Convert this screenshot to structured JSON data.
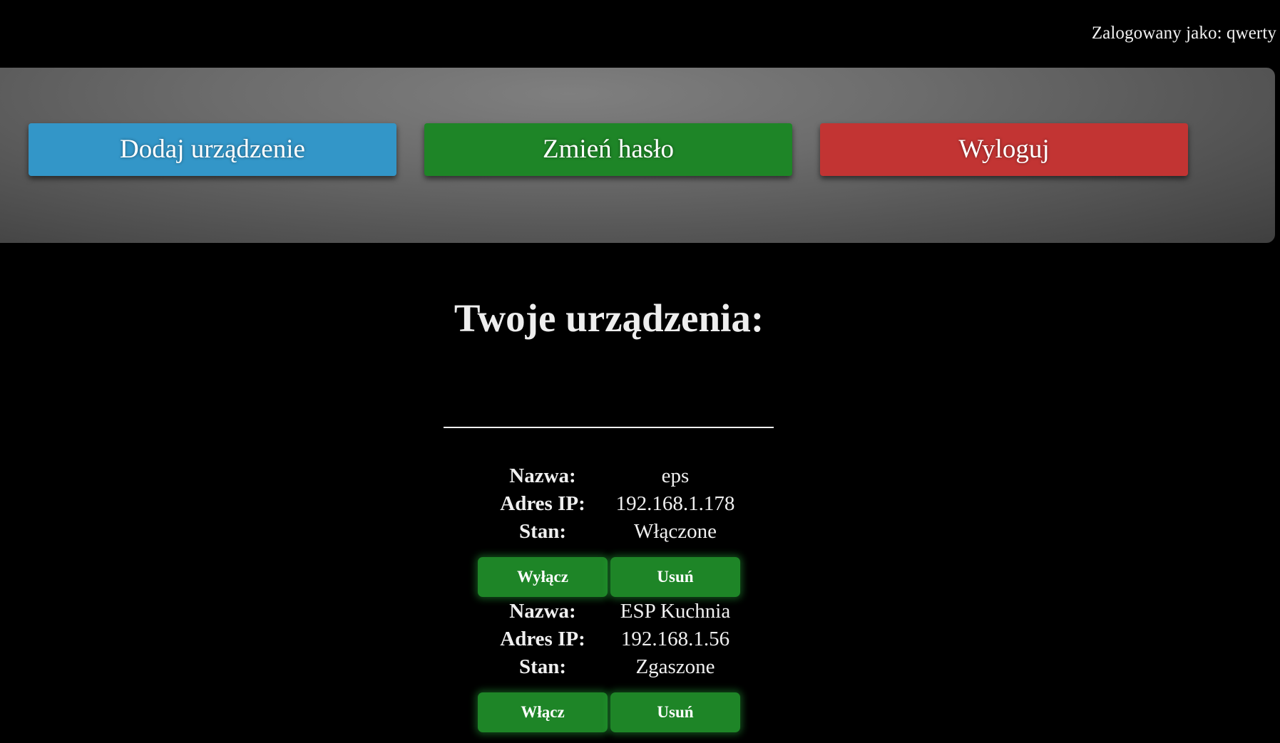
{
  "header": {
    "logged_in_label": "Zalogowany jako: qwerty"
  },
  "toolbar": {
    "add_device_label": "Dodaj urządzenie",
    "change_password_label": "Zmień hasło",
    "logout_label": "Wyloguj"
  },
  "main": {
    "title": "Twoje urządzenia:",
    "field_labels": {
      "name": "Nazwa:",
      "ip": "Adres IP:",
      "state": "Stan:"
    },
    "devices": [
      {
        "name": "eps",
        "ip": "192.168.1.178",
        "state": "Włączone",
        "toggle_label": "Wyłącz",
        "delete_label": "Usuń"
      },
      {
        "name": "ESP Kuchnia",
        "ip": "192.168.1.56",
        "state": "Zgaszone",
        "toggle_label": "Włącz",
        "delete_label": "Usuń"
      }
    ]
  },
  "colors": {
    "background": "#000000",
    "add_button": "#3396c8",
    "change_password_button": "#1e8527",
    "logout_button": "#c23433",
    "device_action_button": "#1e8527"
  }
}
